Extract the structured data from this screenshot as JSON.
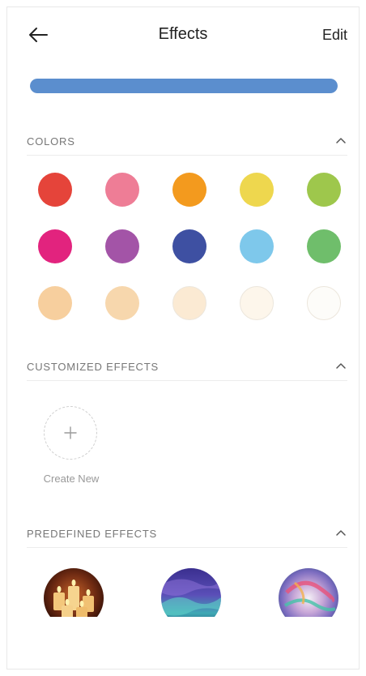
{
  "header": {
    "title": "Effects",
    "edit_label": "Edit"
  },
  "brightness": {
    "level_percent": 100,
    "fill_color": "#5b8ece"
  },
  "colors_section": {
    "title": "COLORS",
    "swatches": [
      "#e5443a",
      "#ee7d96",
      "#f39a1e",
      "#eed74e",
      "#9ec74c",
      "#e2237e",
      "#a354a7",
      "#3e50a2",
      "#7ec8eb",
      "#6fbe6b",
      "#f7cf9e",
      "#f7d7ad",
      "#fbead3",
      "#fdf6eb",
      "#fdfcf9"
    ]
  },
  "customized_section": {
    "title": "CUSTOMIZED EFFECTS",
    "create_new_label": "Create New"
  },
  "predefined_section": {
    "title": "PREDEFINED EFFECTS",
    "effects": [
      {
        "icon": "candles-thumbnail"
      },
      {
        "icon": "aurora-thumbnail"
      },
      {
        "icon": "swirl-thumbnail"
      }
    ]
  }
}
